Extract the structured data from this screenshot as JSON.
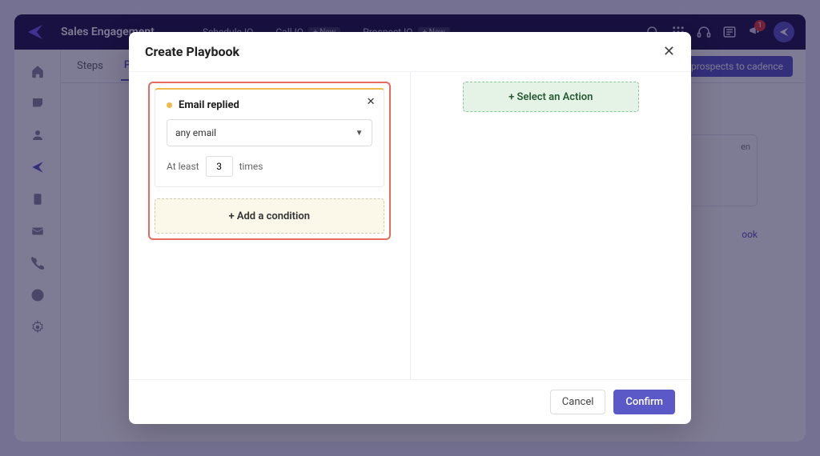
{
  "header": {
    "brand": "Sales Engagement",
    "items": [
      {
        "label": "Schedule IQ"
      },
      {
        "label": "Call IQ",
        "pill": "+ New"
      },
      {
        "label": "Prospect IQ",
        "pill": "+ New"
      }
    ],
    "badge_count": "1"
  },
  "tabs": {
    "steps": "Steps",
    "playbook": "Playbook",
    "add_prospects": "Add prospects to cadence"
  },
  "bg": {
    "card_text": "en",
    "link_text": "ook"
  },
  "modal": {
    "title": "Create Playbook",
    "condition": {
      "name": "Email replied",
      "select_value": "any email",
      "freq_prefix": "At least",
      "freq_value": "3",
      "freq_suffix": "times"
    },
    "add_condition": "+ Add a condition",
    "select_action": "+ Select an Action",
    "cancel": "Cancel",
    "confirm": "Confirm"
  }
}
